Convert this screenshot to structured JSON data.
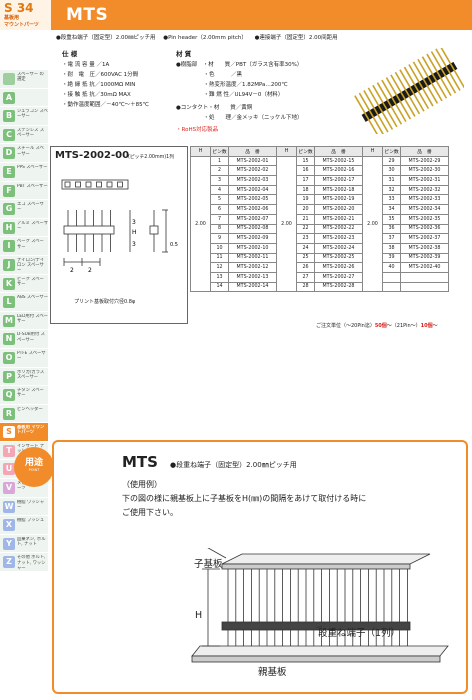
{
  "header": {
    "page": "S 34",
    "badge_line1": "基板用",
    "badge_line2": "マウントパーツ",
    "title": "MTS",
    "features": [
      "●段重ね端子（固定型）2.00㎜ピッチ用",
      "●Pin header（2.00mm pitch）",
      "●連接端子（固定型）2.00间距用"
    ]
  },
  "colors": {
    "accent": "#f28b2a",
    "accent_dark": "#d85c00",
    "red": "#d8251f"
  },
  "sidebar": [
    {
      "letter": "",
      "label": "スペーサー の選定",
      "color": "#9fcf9f"
    },
    {
      "letter": "A",
      "label": "",
      "color": "#7cc07c"
    },
    {
      "letter": "B",
      "label": "ジュラコン スペーサー",
      "color": "#7cc07c"
    },
    {
      "letter": "C",
      "label": "ステンレス スペーサー",
      "color": "#7cc07c"
    },
    {
      "letter": "D",
      "label": "スチール スペーサー",
      "color": "#7cc07c"
    },
    {
      "letter": "E",
      "label": "PPS スペーサー",
      "color": "#7cc07c"
    },
    {
      "letter": "F",
      "label": "PBT スペーサー",
      "color": "#7cc07c"
    },
    {
      "letter": "G",
      "label": "エコ スペーサー",
      "color": "#7cc07c"
    },
    {
      "letter": "H",
      "label": "アルミ スペーサー",
      "color": "#7cc07c"
    },
    {
      "letter": "I",
      "label": "ベーク スペーサー",
      "color": "#7cc07c"
    },
    {
      "letter": "J",
      "label": "ナイロン/ナイロン スペーサー",
      "color": "#7cc07c"
    },
    {
      "letter": "K",
      "label": "ピーク スペーサー",
      "color": "#7cc07c"
    },
    {
      "letter": "L",
      "label": "ABS スペーサー",
      "color": "#7cc07c"
    },
    {
      "letter": "M",
      "label": "LED用付 スペーサー",
      "color": "#7cc07c"
    },
    {
      "letter": "N",
      "label": "D-SUB用付 スペーサー",
      "color": "#7cc07c"
    },
    {
      "letter": "O",
      "label": "PTFE スペーサー",
      "color": "#7cc07c"
    },
    {
      "letter": "P",
      "label": "ポリカ/ガラス スペーサー",
      "color": "#7cc07c"
    },
    {
      "letter": "Q",
      "label": "チタン スペーサー",
      "color": "#7cc07c"
    },
    {
      "letter": "R",
      "label": "ピンヘッダー",
      "color": "#7cc07c"
    },
    {
      "letter": "S",
      "label": "基板用 マウントパーツ",
      "color": "#f28b2a",
      "active": true
    },
    {
      "letter": "T",
      "label": "インサート ナット",
      "color": "#f3a6b6"
    },
    {
      "letter": "U",
      "label": "圧入/カシメ ナット",
      "color": "#f3a6b6"
    },
    {
      "letter": "V",
      "label": "メカニカル パーツ",
      "color": "#d8a6d8"
    },
    {
      "letter": "W",
      "label": "樹脂 ワッシャー",
      "color": "#9fb6e6"
    },
    {
      "letter": "X",
      "label": "樹脂 ブッシュ",
      "color": "#9fb6e6"
    },
    {
      "letter": "Y",
      "label": "皿乗ネジ, ボルト, ナット",
      "color": "#9fb6e6"
    },
    {
      "letter": "Z",
      "label": "その他 ボルト, ナット, ワッシャー",
      "color": "#9fb6e6"
    }
  ],
  "spec": {
    "heading": "仕 様",
    "lines": [
      "・電 流 容 量 ／1A",
      "・耐　電　圧／600VAC 1分間",
      "・絶 縁 抵 抗／1000MΩ MIN",
      "・接 触 抵 抗／30mΩ MAX",
      "・動作温度範囲／－40℃～＋85℃"
    ]
  },
  "material": {
    "heading": "材 質",
    "lines": [
      "●樹脂部　・材　　質／PBT（ガラス含有率30%）",
      "　　　　　・色　　　／黒",
      "　　　　　・熱変形温度／1.82MPa…200℃",
      "　　　　　・難 燃 性／UL94V－0（材料）",
      "●コンタクト・材　　質／黄銅",
      "　　　　　・処　　理／金メッキ（ニッケル下地）"
    ],
    "rohs": "・RoHS対応製品"
  },
  "model": {
    "name": "MTS-2002-00",
    "note": "(ピッチ2.00mm)1列",
    "dims": [
      "2",
      "2",
      "3",
      "H",
      "3",
      "0.5"
    ],
    "drill_note": "プリント基板取付穴径0.8φ"
  },
  "table": {
    "headers": [
      "H",
      "ピン数",
      "品　番"
    ],
    "h_value": "2.00",
    "columns": [
      [
        [
          "1",
          "MTS-2002-01"
        ],
        [
          "2",
          "MTS-2002-02"
        ],
        [
          "3",
          "MTS-2002-03"
        ],
        [
          "4",
          "MTS-2002-04"
        ],
        [
          "5",
          "MTS-2002-05"
        ],
        [
          "6",
          "MTS-2002-06"
        ],
        [
          "7",
          "MTS-2002-07"
        ],
        [
          "8",
          "MTS-2002-08"
        ],
        [
          "9",
          "MTS-2002-09"
        ],
        [
          "10",
          "MTS-2002-10"
        ],
        [
          "11",
          "MTS-2002-11"
        ],
        [
          "12",
          "MTS-2002-12"
        ],
        [
          "13",
          "MTS-2002-13"
        ],
        [
          "14",
          "MTS-2002-14"
        ]
      ],
      [
        [
          "15",
          "MTS-2002-15"
        ],
        [
          "16",
          "MTS-2002-16"
        ],
        [
          "17",
          "MTS-2002-17"
        ],
        [
          "18",
          "MTS-2002-18"
        ],
        [
          "19",
          "MTS-2002-19"
        ],
        [
          "20",
          "MTS-2002-20"
        ],
        [
          "21",
          "MTS-2002-21"
        ],
        [
          "22",
          "MTS-2002-22"
        ],
        [
          "23",
          "MTS-2002-23"
        ],
        [
          "24",
          "MTS-2002-24"
        ],
        [
          "25",
          "MTS-2002-25"
        ],
        [
          "26",
          "MTS-2002-26"
        ],
        [
          "27",
          "MTS-2002-27"
        ],
        [
          "28",
          "MTS-2002-28"
        ]
      ],
      [
        [
          "29",
          "MTS-2002-29"
        ],
        [
          "30",
          "MTS-2002-30"
        ],
        [
          "31",
          "MTS-2002-31"
        ],
        [
          "32",
          "MTS-2002-32"
        ],
        [
          "33",
          "MTS-2002-33"
        ],
        [
          "34",
          "MTS-2002-34"
        ],
        [
          "35",
          "MTS-2002-35"
        ],
        [
          "36",
          "MTS-2002-36"
        ],
        [
          "37",
          "MTS-2002-37"
        ],
        [
          "38",
          "MTS-2002-38"
        ],
        [
          "39",
          "MTS-2002-39"
        ],
        [
          "40",
          "MTS-2002-40"
        ],
        [
          "",
          ""
        ],
        [
          "",
          ""
        ]
      ]
    ],
    "order_note_prefix": "ご注文単位（～20Pin迄）",
    "order_qty1": "50個",
    "order_note_mid": "～（21Pin～）",
    "order_qty2": "10個",
    "order_note_suffix": "～"
  },
  "usage": {
    "tab": "用途",
    "tab_sub": "POINT",
    "title": "MTS",
    "desc": "●段重ね端子（固定型）2.00㎜ピッチ用",
    "example": "（使用例）",
    "text1": "下の図の様に親基板上に子基板をH(㎜)の間隔をあけて取付ける時に",
    "text2": "ご使用下さい。",
    "label_child": "子基板",
    "label_h": "H",
    "label_terminal": "段重ね端子（1列）",
    "label_parent": "親基板"
  }
}
